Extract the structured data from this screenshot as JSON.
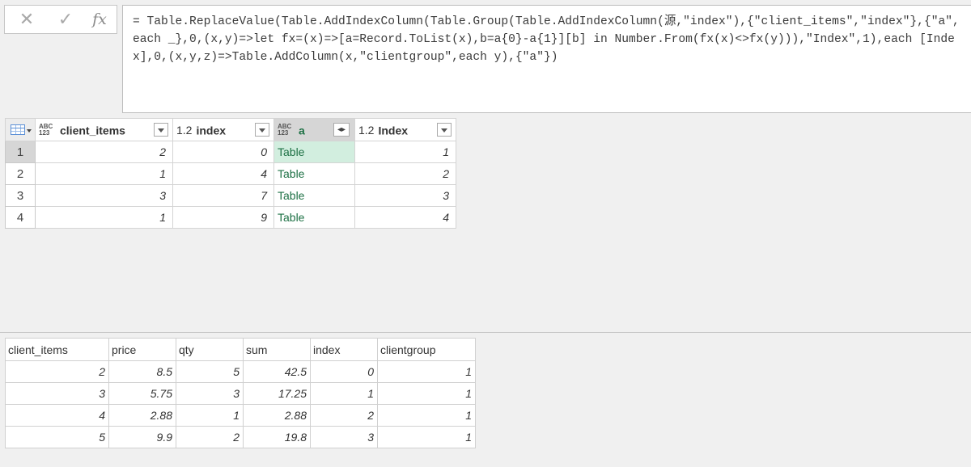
{
  "formula_bar": {
    "cancel_icon": "✕",
    "commit_icon": "✓",
    "fx_label": "fx",
    "formula": "= Table.ReplaceValue(Table.AddIndexColumn(Table.Group(Table.AddIndexColumn(源,\"index\"),{\"client_items\",\"index\"},{\"a\",each _},0,(x,y)=>let fx=(x)=>[a=Record.ToList(x),b=a{0}-a{1}][b] in Number.From(fx(x)<>fx(y))),\"Index\",1),each [Index],0,(x,y,z)=>Table.AddColumn(x,\"clientgroup\",each y),{\"a\"})"
  },
  "query_table": {
    "columns": [
      {
        "type": "ABC 123",
        "type_top": "ABC",
        "type_bottom": "123",
        "label": "client_items"
      },
      {
        "type": "1.2",
        "label": "index"
      },
      {
        "type": "ABC 123",
        "type_top": "ABC",
        "type_bottom": "123",
        "label": "a"
      },
      {
        "type": "1.2",
        "label": "Index"
      }
    ],
    "rows": [
      {
        "rn": "1",
        "client_items": "2",
        "index": "0",
        "a": "Table",
        "Index": "1"
      },
      {
        "rn": "2",
        "client_items": "1",
        "index": "4",
        "a": "Table",
        "Index": "2"
      },
      {
        "rn": "3",
        "client_items": "3",
        "index": "7",
        "a": "Table",
        "Index": "3"
      },
      {
        "rn": "4",
        "client_items": "1",
        "index": "9",
        "a": "Table",
        "Index": "4"
      }
    ]
  },
  "preview_table": {
    "columns": [
      "client_items",
      "price",
      "qty",
      "sum",
      "index",
      "clientgroup"
    ],
    "rows": [
      [
        "2",
        "8.5",
        "5",
        "42.5",
        "0",
        "1"
      ],
      [
        "3",
        "5.75",
        "3",
        "17.25",
        "1",
        "1"
      ],
      [
        "4",
        "2.88",
        "1",
        "2.88",
        "2",
        "1"
      ],
      [
        "5",
        "9.9",
        "2",
        "19.8",
        "3",
        "1"
      ]
    ]
  },
  "colors": {
    "table_value": "#1e7145",
    "selected_cell": "#d2eedf",
    "selected_row_number": "#d6d6d6"
  }
}
